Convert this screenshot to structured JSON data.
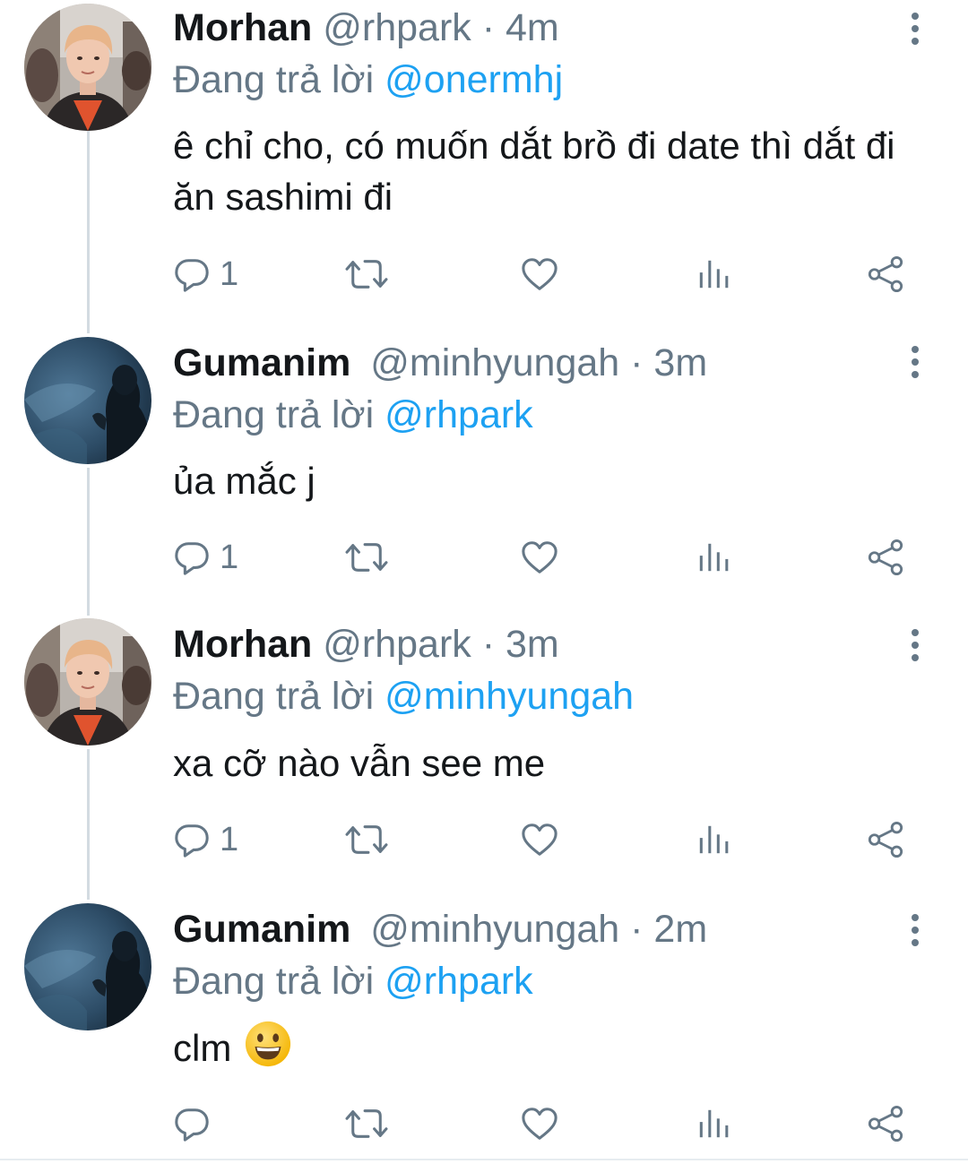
{
  "colors": {
    "primary_text": "#14171a",
    "secondary_text": "#657786",
    "link": "#1da1f2",
    "thread_line": "#d3dbe1"
  },
  "replying_prefix": "Đang trả lời",
  "tweets": [
    {
      "name": "Morhan",
      "handle": "@rhpark",
      "time": "· 4m",
      "reply_to": "@onermhj",
      "text": "ê chỉ cho, có muốn dắt brồ đi date thì dắt đi ăn sashimi đi",
      "reply_count": "1",
      "avatar": "avatar-morhan"
    },
    {
      "name": "Gumanim",
      "handle": "@minhyungah",
      "time": "· 3m",
      "reply_to": "@rhpark",
      "text": "ủa mắc j",
      "reply_count": "1",
      "avatar": "avatar-gumanim"
    },
    {
      "name": "Morhan",
      "handle": "@rhpark",
      "time": "· 3m",
      "reply_to": "@minhyungah",
      "text": "xa cỡ nào vẫn see me",
      "reply_count": "1",
      "avatar": "avatar-morhan"
    },
    {
      "name": "Gumanim",
      "handle": "@minhyungah",
      "time": "· 2m",
      "reply_to": "@rhpark",
      "text": "clm",
      "emoji": "grinning-face-emoji",
      "reply_count": "",
      "avatar": "avatar-gumanim"
    }
  ],
  "icons": {
    "reply": "reply-icon",
    "retweet": "retweet-icon",
    "like": "heart-icon",
    "analytics": "analytics-icon",
    "share": "share-icon",
    "more": "more-vertical-icon"
  }
}
